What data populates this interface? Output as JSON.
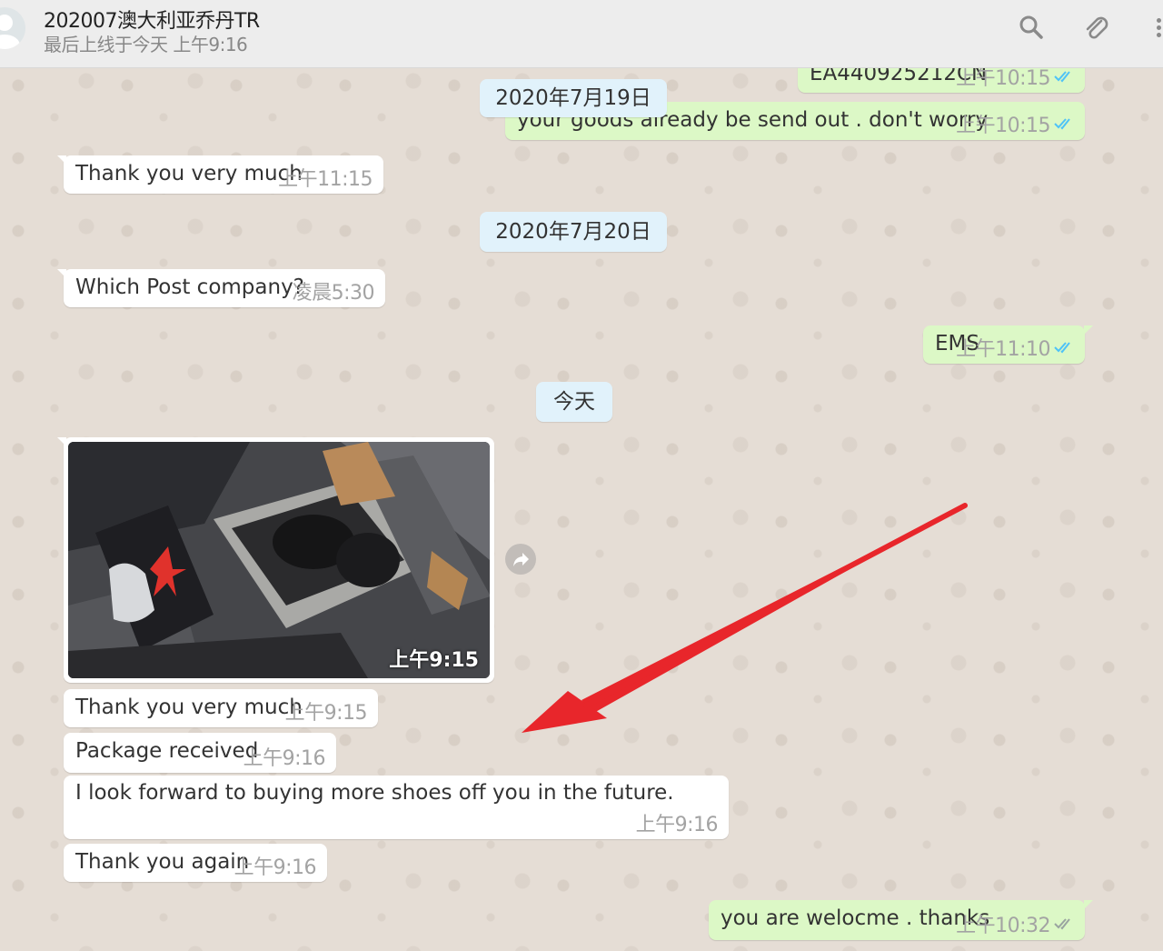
{
  "header": {
    "title": "202007澳大利亚乔丹TR",
    "status": "最后上线于今天 上午9:16",
    "icons": [
      "search-icon",
      "attach-icon",
      "menu-icon"
    ]
  },
  "colors": {
    "incoming_bubble": "#ffffff",
    "outgoing_bubble": "#dcf8c6",
    "date_pill": "#e1f2fb",
    "read_ticks": "#4fc3f7",
    "annotation_arrow": "#e8262b"
  },
  "messages": [
    {
      "dir": "out",
      "text": "EA440925212CN",
      "time": "上午10:15",
      "ticks": "read"
    },
    {
      "dir": "out",
      "text": "your goods already be send out . don't worry",
      "time": "上午10:15",
      "ticks": "read"
    },
    {
      "dir": "date",
      "text": "2020年7月19日"
    },
    {
      "dir": "in",
      "text": "Thank you very much",
      "time": "上午11:15"
    },
    {
      "dir": "date",
      "text": "2020年7月20日"
    },
    {
      "dir": "in",
      "text": "Which Post company?",
      "time": "凌晨5:30"
    },
    {
      "dir": "out",
      "text": "EMS",
      "time": "上午11:10",
      "ticks": "read"
    },
    {
      "dir": "date",
      "text": "今天"
    },
    {
      "dir": "in",
      "type": "image",
      "image": "shoe-box-photo",
      "time": "上午9:15"
    },
    {
      "dir": "in",
      "text": "Thank you very much",
      "time": "上午9:15"
    },
    {
      "dir": "in",
      "text": "Package received",
      "time": "上午9:16"
    },
    {
      "dir": "in",
      "text": "I look forward to buying more shoes off you in the future.",
      "time": "上午9:16"
    },
    {
      "dir": "in",
      "text": "Thank you again",
      "time": "上午9:16"
    },
    {
      "dir": "out",
      "text": "you are welocme . thanks",
      "time": "上午10:32",
      "ticks": "delivered"
    }
  ]
}
